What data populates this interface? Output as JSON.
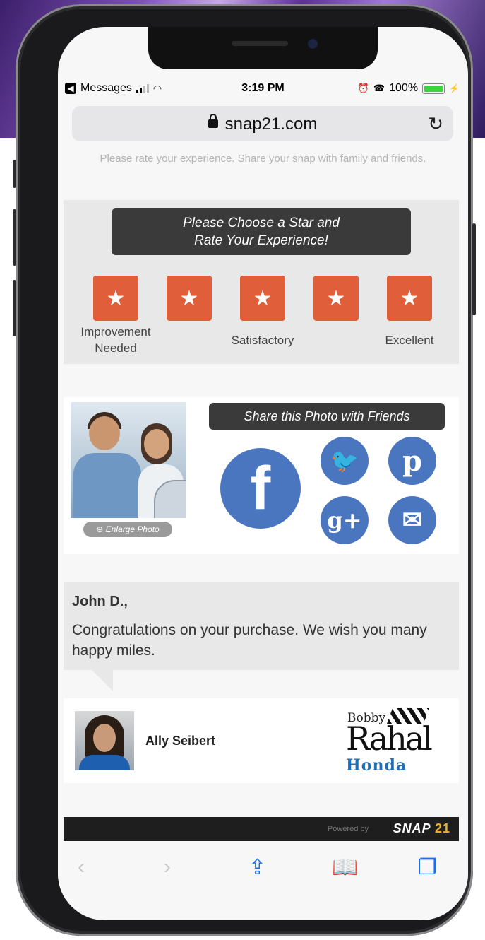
{
  "status_bar": {
    "back_app": "Messages",
    "time": "3:19 PM",
    "battery": "100%"
  },
  "browser": {
    "url": "snap21.com"
  },
  "tagline": "Please rate your experience. Share your snap with family and friends.",
  "rating": {
    "heading": "Please Choose a Star and\nRate Your Experience!",
    "labels": {
      "low": "Improvement\nNeeded",
      "mid": "Satisfactory",
      "high": "Excellent"
    }
  },
  "share": {
    "heading": "Share this Photo with Friends",
    "enlarge": "Enlarge Photo",
    "icons": [
      "facebook-icon",
      "twitter-icon",
      "pinterest-icon",
      "google-plus-icon",
      "email-icon"
    ]
  },
  "message": {
    "recipient": "John D.,",
    "body": "Congratulations on your purchase. We wish you many happy miles."
  },
  "agent": {
    "name": "Ally Seibert"
  },
  "dealer": {
    "line1": "Bobby",
    "line2": "Rahal",
    "line3": "Honda"
  },
  "footer": {
    "powered_by": "Powered by",
    "brand": "SNAP",
    "brand_num": "21"
  },
  "colors": {
    "star": "#e05f3a",
    "social": "#4a76c0",
    "header_dark": "#3a3a3a"
  }
}
